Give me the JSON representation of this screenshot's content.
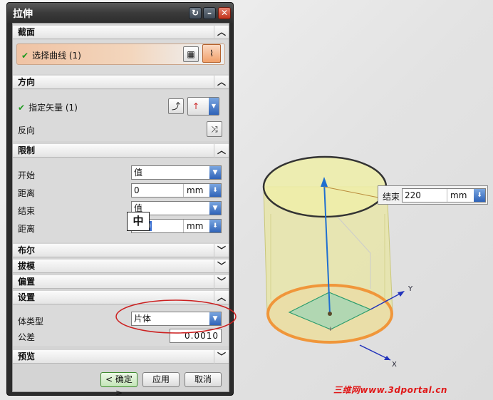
{
  "dialog": {
    "title": "拉伸",
    "sections": {
      "section": "截面",
      "direction": "方向",
      "limits": "限制",
      "boolean": "布尔",
      "draft": "拔模",
      "offset": "偏置",
      "settings": "设置",
      "preview": "预览"
    },
    "section_body": {
      "select_curve": "选择曲线 (1)"
    },
    "direction_body": {
      "specify_vector": "指定矢量 (1)",
      "reverse": "反向"
    },
    "limits_body": {
      "start_label": "开始",
      "start_value": "值",
      "start_distance_label": "距离",
      "start_distance": "0",
      "start_unit": "mm",
      "end_label": "结束",
      "end_value": "值",
      "end_distance_label": "距离",
      "end_distance": "220",
      "end_unit": "mm"
    },
    "settings_body": {
      "body_type_label": "体类型",
      "body_type": "片体",
      "tolerance_label": "公差",
      "tolerance": "0.0010"
    },
    "buttons": {
      "ok": "< 确定 >",
      "apply": "应用",
      "cancel": "取消"
    },
    "ime_indicator": "中"
  },
  "viewport": {
    "end_tag": {
      "label": "结束",
      "value": "220",
      "unit": "mm"
    },
    "axes": {
      "x": "X",
      "y": "Y"
    }
  },
  "watermark": "三维网www.3dportal.cn",
  "colors": {
    "title_bar": "#3a3a3a",
    "accent_orange": "#f0a060",
    "check_green": "#1e9a1e",
    "cylinder_fill": "#e6e49a",
    "base_circle": "#f0963a",
    "vector_blue": "#1f6fd0",
    "highlight_ring": "#cc1f1f"
  }
}
